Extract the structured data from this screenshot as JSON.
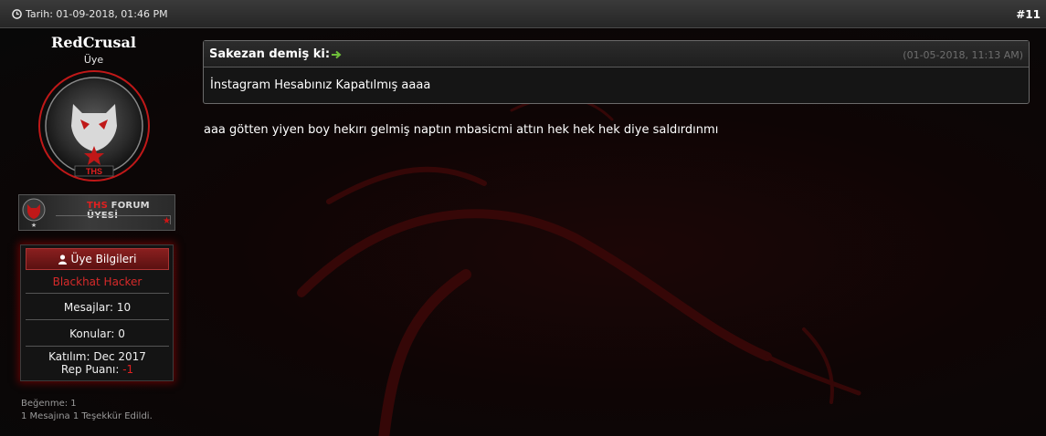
{
  "post": {
    "date_label": "Tarih: 01-09-2018, 01:46 PM",
    "number": "#11",
    "message": "aaa götten yiyen boy hekırı gelmiş naptın mbasicmi attın hek hek hek diye saldırdınmı"
  },
  "user": {
    "name": "RedCrusal",
    "title": "Üye",
    "rank_text_red": "THS",
    "rank_text": " FORUM ÜYESİ",
    "avatar_label": "THS",
    "info_header": "Üye Bilgileri",
    "group": "Blackhat Hacker",
    "posts": "Mesajlar: 10",
    "threads": "Konular: 0",
    "joined": "Katılım: Dec 2017",
    "rep_label": "Rep Puanı: ",
    "rep_value": "-1",
    "likes": "Beğenme: 1",
    "thanks": "1 Mesajına 1 Teşekkür Edildi."
  },
  "quote": {
    "author": "Sakezan demiş ki:",
    "date": "(01-05-2018, 11:13 AM)",
    "text": "İnstagram Hesabınız Kapatılmış aaaa"
  },
  "colors": {
    "accent_red": "#e02020",
    "header_bg": "#2e2e2e",
    "arrow_green": "#6fbf3a"
  }
}
